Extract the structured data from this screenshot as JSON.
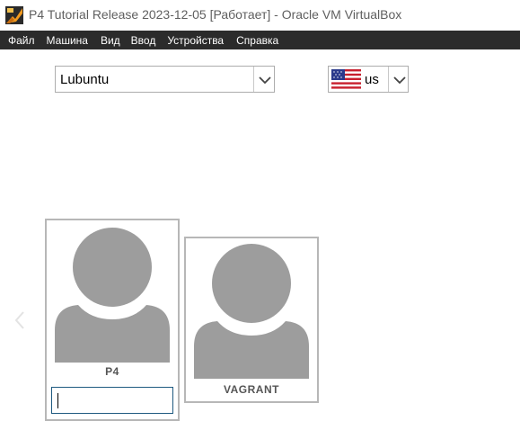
{
  "window": {
    "title": "P4 Tutorial Release 2023-12-05 [Работает] - Oracle VM VirtualBox",
    "app_icon": "virtualbox-icon"
  },
  "menubar": {
    "items": [
      "Файл",
      "Машина",
      "Вид",
      "Ввод",
      "Устройства",
      "Справка"
    ]
  },
  "login": {
    "session": {
      "value": "Lubuntu",
      "icon": "chevron-down-icon"
    },
    "keyboard": {
      "value": "us",
      "flag": "us-flag-icon",
      "icon": "chevron-down-icon"
    },
    "prev_icon": "chevron-left-icon",
    "users": [
      {
        "name": "P4",
        "selected": true,
        "password_value": ""
      },
      {
        "name": "VAGRANT",
        "selected": false
      }
    ]
  },
  "colors": {
    "menubar_bg": "#2b2b2b",
    "avatar_gray": "#9d9d9d",
    "tile_border": "#b7b7b7",
    "input_border_focus": "#1e5a80"
  }
}
